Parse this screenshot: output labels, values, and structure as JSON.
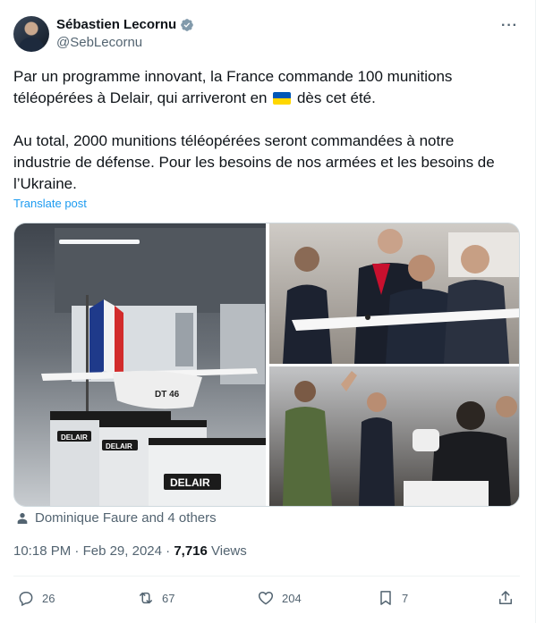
{
  "author": {
    "name": "Sébastien Lecornu",
    "handle": "@SebLecornu",
    "verified": true
  },
  "more_icon": "more-dots-icon",
  "tweet": {
    "paragraph1_part1": "Par un programme innovant, la France commande 100 munitions téléopérées à Delair, qui arriveront en",
    "paragraph1_part2": "dès cet été.",
    "paragraph2": "Au total, 2000 munitions téléopérées seront commandées à notre industrie de défense. Pour les besoins de nos armées et les besoins de l’Ukraine.",
    "flag_emoji": "ukraine-flag"
  },
  "translate_label": "Translate post",
  "media": {
    "image_count": 3,
    "drone_label": "DT 46",
    "crate_labels": [
      "DELAIR",
      "DELAIR",
      "DELAIR"
    ]
  },
  "tagged": "Dominique Faure and 4 others",
  "meta": {
    "time": "10:18 PM",
    "separator": " · ",
    "date": "Feb 29, 2024",
    "dot": " · ",
    "views_count": "7,716",
    "views_label": " Views"
  },
  "actions": {
    "replies": "26",
    "reposts": "67",
    "likes": "204",
    "bookmarks": "7"
  },
  "colors": {
    "text": "#0f1419",
    "secondary": "#536471",
    "link": "#1d9bf0",
    "verified": "#829aab",
    "flag_blue": "#0057b7",
    "flag_yellow": "#ffd700"
  }
}
